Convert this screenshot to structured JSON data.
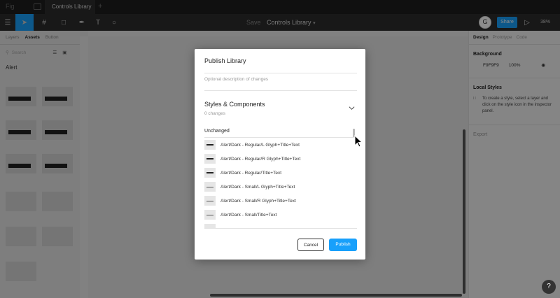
{
  "tabbar": {
    "logo": "Fig",
    "tab_title": "Controls Library",
    "new_tab": "+"
  },
  "toolbar": {
    "draft_label": "Save",
    "file_name": "Controls Library",
    "share_label": "Share",
    "zoom": "38%",
    "avatar_initial": "G"
  },
  "left_panel": {
    "tabs": [
      "Layers",
      "Assets",
      "Button"
    ],
    "search_placeholder": "Search",
    "section_title": "Alert"
  },
  "right_panel": {
    "tabs": [
      "Design",
      "Prototype",
      "Code"
    ],
    "background_heading": "Background",
    "background_hex": "F9F9F9",
    "background_opacity": "100%",
    "local_styles_heading": "Local Styles",
    "local_styles_hint": "To create a style, select a layer and click on the style icon in the inspector panel.",
    "export_heading": "Export"
  },
  "modal": {
    "title": "Publish Library",
    "description_placeholder": "Optional description of changes",
    "section_title": "Styles & Components",
    "change_count": "0 changes",
    "unchanged_label": "Unchanged",
    "items": [
      {
        "label": "Alert/Dark - Regular/L Glyph+Title+Text"
      },
      {
        "label": "Alert/Dark - Regular/R Glyph+Title+Text"
      },
      {
        "label": "Alert/Dark - Regular/Title+Text"
      },
      {
        "label": "Alert/Dark - Small/L Glyph+Title+Text"
      },
      {
        "label": "Alert/Dark - Small/R Glyph+Title+Text"
      },
      {
        "label": "Alert/Dark - Small/Title+Text"
      }
    ],
    "cancel_label": "Cancel",
    "publish_label": "Publish"
  },
  "help_label": "?",
  "colors": {
    "accent": "#18a0fb",
    "toolbar": "#2c2c2c"
  }
}
